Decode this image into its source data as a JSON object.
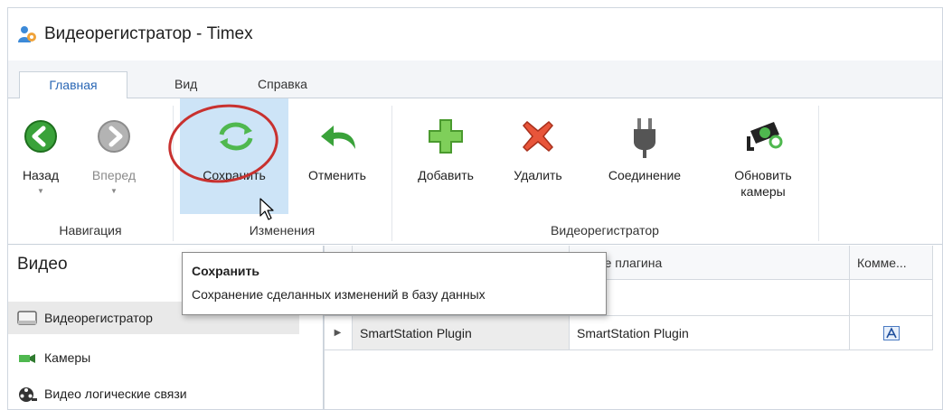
{
  "window": {
    "title": "Видеорегистратор - Timex"
  },
  "tabs": [
    {
      "label": "Главная",
      "active": true
    },
    {
      "label": "Вид",
      "active": false
    },
    {
      "label": "Справка",
      "active": false
    }
  ],
  "ribbon": {
    "groups": {
      "navigation": "Навигация",
      "changes": "Изменения",
      "recorder": "Видеорегистратор"
    },
    "buttons": {
      "back": "Назад",
      "forward": "Вперед",
      "save": "Сохранить",
      "cancel": "Отменить",
      "add": "Добавить",
      "delete": "Удалить",
      "connect": "Соединение",
      "refresh_line1": "Обновить",
      "refresh_line2": "камеры"
    }
  },
  "tooltip": {
    "title": "Сохранить",
    "body": "Сохранение сделанных изменений в базу данных"
  },
  "nav": {
    "header": "Видео",
    "items": [
      {
        "label": "Видеорегистратор",
        "icon": "recorder-icon",
        "selected": true
      },
      {
        "label": "Камеры",
        "icon": "camera-icon",
        "selected": false
      },
      {
        "label": "Видео логические связи",
        "icon": "film-reel-icon",
        "selected": false
      }
    ]
  },
  "grid": {
    "columns": [
      "вание плагина",
      "Комме..."
    ],
    "rows": [
      {
        "name": "SmartStation Plugin",
        "plugin": "SmartStation Plugin"
      }
    ]
  },
  "colors": {
    "accent": "#2a67b5",
    "selection": "#cde4f7",
    "annotation": "#c8312f"
  }
}
